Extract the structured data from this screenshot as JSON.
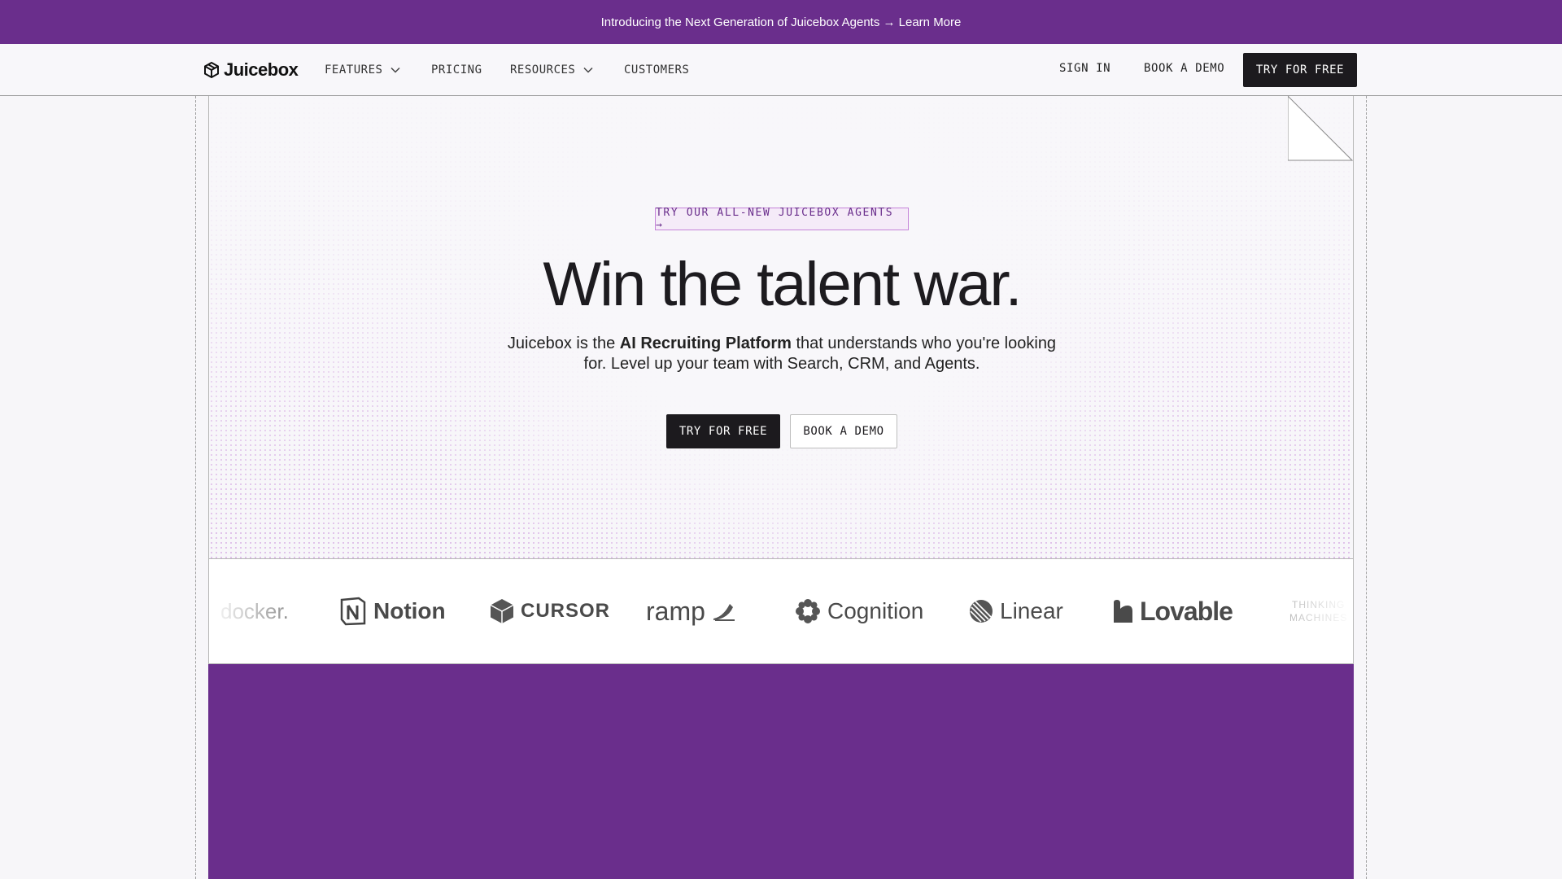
{
  "announcement": {
    "text": "Introducing the Next Generation of Juicebox Agents → Learn More"
  },
  "nav": {
    "brand": "Juicebox",
    "items": [
      {
        "label": "FEATURES",
        "has_dropdown": true
      },
      {
        "label": "PRICING",
        "has_dropdown": false
      },
      {
        "label": "RESOURCES",
        "has_dropdown": true
      },
      {
        "label": "CUSTOMERS",
        "has_dropdown": false
      }
    ],
    "sign_in": "SIGN IN",
    "book_demo": "BOOK A DEMO",
    "try_free": "TRY FOR FREE"
  },
  "hero": {
    "badge": "TRY OUR ALL-NEW JUICEBOX AGENTS →",
    "headline": "Win the talent war.",
    "sub_pre": "Juicebox is the ",
    "sub_bold": "AI Recruiting Platform",
    "sub_post": " that understands who you're looking for. Level up your team with Search, CRM, and Agents.",
    "cta_primary": "TRY FOR FREE",
    "cta_secondary": "BOOK A DEMO"
  },
  "logos": {
    "docker": "docker.",
    "notion": "Notion",
    "cursor": "CURSOR",
    "ramp": "ramp",
    "cognition": "Cognition",
    "linear": "Linear",
    "lovable": "Lovable",
    "thinking_1": "THINKING",
    "thinking_2": "MACHINES"
  },
  "colors": {
    "brand_purple": "#6a2e8c",
    "dark_button": "#1c1a1e",
    "badge_border": "#c583d8"
  }
}
